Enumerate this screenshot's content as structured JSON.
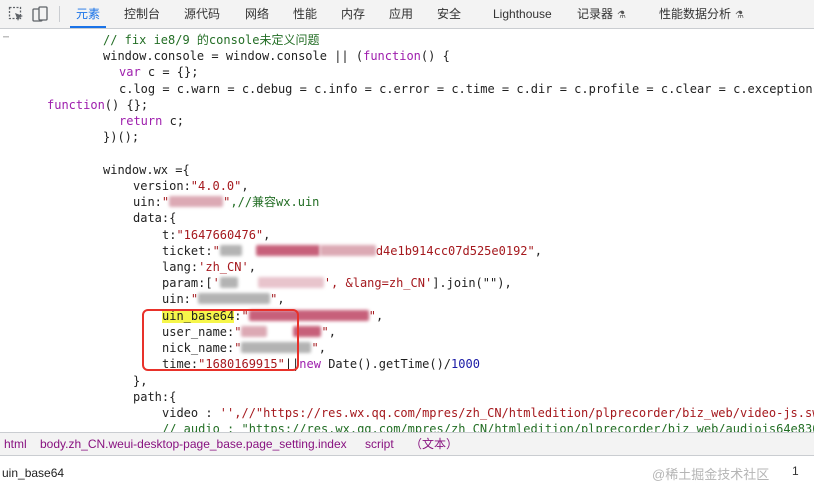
{
  "toolbar": {
    "tabs": [
      {
        "label": "元素",
        "active": true
      },
      {
        "label": "控制台"
      },
      {
        "label": "源代码"
      },
      {
        "label": "网络"
      },
      {
        "label": "性能"
      },
      {
        "label": "内存"
      },
      {
        "label": "应用"
      },
      {
        "label": "安全"
      },
      {
        "label": "Lighthouse"
      },
      {
        "label": "记录器"
      },
      {
        "label": "性能数据分析"
      }
    ],
    "accent_color": "#1a73e8"
  },
  "code": {
    "comment_ie": "// fix ie8/9 的console未定义问题",
    "console_assign": "window.console = window.console || (",
    "kw_function": "function",
    "fn_open": "() {",
    "kw_var": "var",
    "var_c": " c = {};",
    "log_chain": "c.log = c.warn = c.debug = c.info = c.error = c.time = c.dir = c.profile = c.clear = c.exception",
    "fn_empty": "() {};",
    "kw_return": "return",
    "return_c": " c;",
    "iife_close": "})();",
    "wx_assign": "window.wx ={",
    "version_key": "version:",
    "version_val": "\"4.0.0\"",
    "uin_key": "uin:",
    "uin_val_partial": "\"",
    "uin_val_tail": "\"",
    "uin_comment": ",//兼容wx.uin",
    "data_open": "data:{",
    "t_key": "t:",
    "t_val": "\"1647660476\"",
    "ticket_key": "ticket:",
    "ticket_tail": "d4e1b914cc07d525e0192\"",
    "lang_key": "lang:",
    "lang_val": "'zh_CN'",
    "param_key": "param:",
    "param_tail": "', &lang=zh_CN'",
    "param_join": "].join(\"\"),",
    "uin2_key": "uin:",
    "uin_base64_key": "uin_base64",
    "uin_base64_colon": ":",
    "user_name_key": "user_name:",
    "nick_name_key": "nick_name:",
    "time_key": "time:",
    "time_val": "\"1680169915\"",
    "time_or": "||",
    "kw_new": "new",
    "time_expr": " Date().getTime()/",
    "time_div": "1000",
    "data_close": "},",
    "path_open": "path:{",
    "video_key": "video : ",
    "video_val": "'',//\"https://res.wx.qq.com/mpres/zh_CN/htmledition/plprecorder/biz_web/video-js.sw",
    "audio_line": "// audio : \"https://res.wx.qq.com/mpres/zh_CN/htmledition/plprecorder/biz_web/audiojs64e830"
  },
  "breadcrumb": {
    "items": [
      "html",
      "body.zh_CN.weui-desktop-page_base.page_setting.index",
      "script",
      "（文本）"
    ]
  },
  "search": {
    "value": "uin_base64",
    "match_count": "1",
    "watermark": "@稀土掘金技术社区"
  },
  "icons": [
    "inspect-element-icon",
    "device-toggle-icon",
    "flask-icon"
  ],
  "highlight_color": "#f6f64a",
  "annotation_color": "#e8312a"
}
